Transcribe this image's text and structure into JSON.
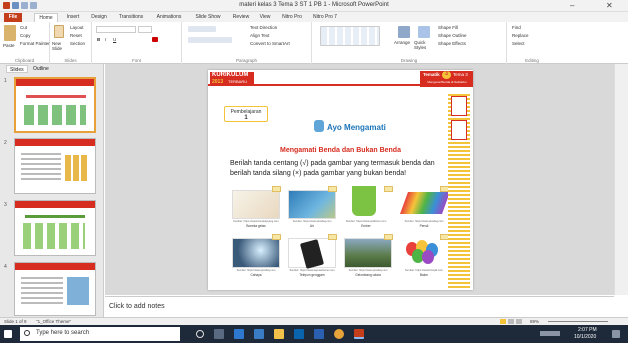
{
  "titlebar": {
    "title": "materi kelas 3 Tema 3 ST 1 PB 1 - Microsoft PowerPoint",
    "min": "–",
    "close": "✕"
  },
  "tabs": [
    "File",
    "Home",
    "Insert",
    "Design",
    "Transitions",
    "Animations",
    "Slide Show",
    "Review",
    "View",
    "Nitro Pro",
    "Nitro Pro 7"
  ],
  "ribbon": {
    "clipboard": {
      "paste": "Paste",
      "cut": "Cut",
      "copy": "Copy",
      "format_painter": "Format Painter",
      "label": "Clipboard"
    },
    "slides": {
      "new_slide": "New Slide",
      "layout": "Layout",
      "reset": "Reset",
      "section": "Section",
      "label": "Slides"
    },
    "font": {
      "label": "Font",
      "bold": "B",
      "italic": "I",
      "underline": "U"
    },
    "paragraph": {
      "label": "Paragraph",
      "text_direction": "Text Direction",
      "align_text": "Align Text",
      "smartart": "Convert to SmartArt"
    },
    "drawing": {
      "label": "Drawing",
      "arrange": "Arrange",
      "quick_styles": "Quick Styles",
      "shape_fill": "Shape Fill",
      "shape_outline": "Shape Outline",
      "shape_effects": "Shape Effects"
    },
    "editing": {
      "label": "Editing",
      "find": "Find",
      "replace": "Replace",
      "select": "Select"
    }
  },
  "leftpane": {
    "tab_slides": "Slides",
    "tab_outline": "Outline",
    "slide_numbers": [
      "1",
      "2",
      "3",
      "4"
    ]
  },
  "slide": {
    "kurikulum": "KURIKULUM",
    "kurikulum_year": "2013",
    "kurikulum_sub": "TERBARU",
    "tema_label": "Tematik",
    "tema_num": "3",
    "tema_suffix": "Tema 3",
    "tema_sub": "Mengenal Benda di Sekitarku",
    "pembelajaran": "Pembelajaran",
    "pembelajaran_num": "1",
    "ayo": "Ayo Mengamati",
    "subtitle": "Mengamati Benda dan Bukan Benda",
    "instruction": "Berilah tanda centang (√) pada gambar yang termasuk benda dan berilah tanda silang (×) pada gambar yang bukan benda!",
    "images": [
      {
        "caption": "Sumber: https://www.bonekapyang.com",
        "name": "Boneka gelas"
      },
      {
        "caption": "Sumber: https://www.pixabay.com",
        "name": "Air"
      },
      {
        "caption": "Sumber: https://www.poldicom.com",
        "name": "Ember"
      },
      {
        "caption": "Sumber: https://www.pixabay.com",
        "name": "Pensil"
      },
      {
        "caption": "Sumber: https://www.pixabay.com",
        "name": "Cahaya"
      },
      {
        "caption": "Sumber: https://www.seputartecno.com",
        "name": "Telepon genggam"
      },
      {
        "caption": "Sumber: https://www.pixabay.com",
        "name": "Gelombang udara"
      },
      {
        "caption": "Sumber: https://www.freepik.com",
        "name": "Balon"
      }
    ]
  },
  "notes": {
    "placeholder": "Click to add notes"
  },
  "statusbar": {
    "slide_info": "Slide 1 of 9",
    "theme": "\"1_Office Theme\"",
    "zoom": "89%"
  },
  "taskbar": {
    "search": "Type here to search",
    "time": "2:07 PM",
    "date": "10/1/2020"
  },
  "colors": {
    "file_tab": "#c43e1c",
    "accent_red": "#d62d20",
    "accent_yellow": "#f3c43a",
    "taskbar": "#1e2a3a"
  }
}
